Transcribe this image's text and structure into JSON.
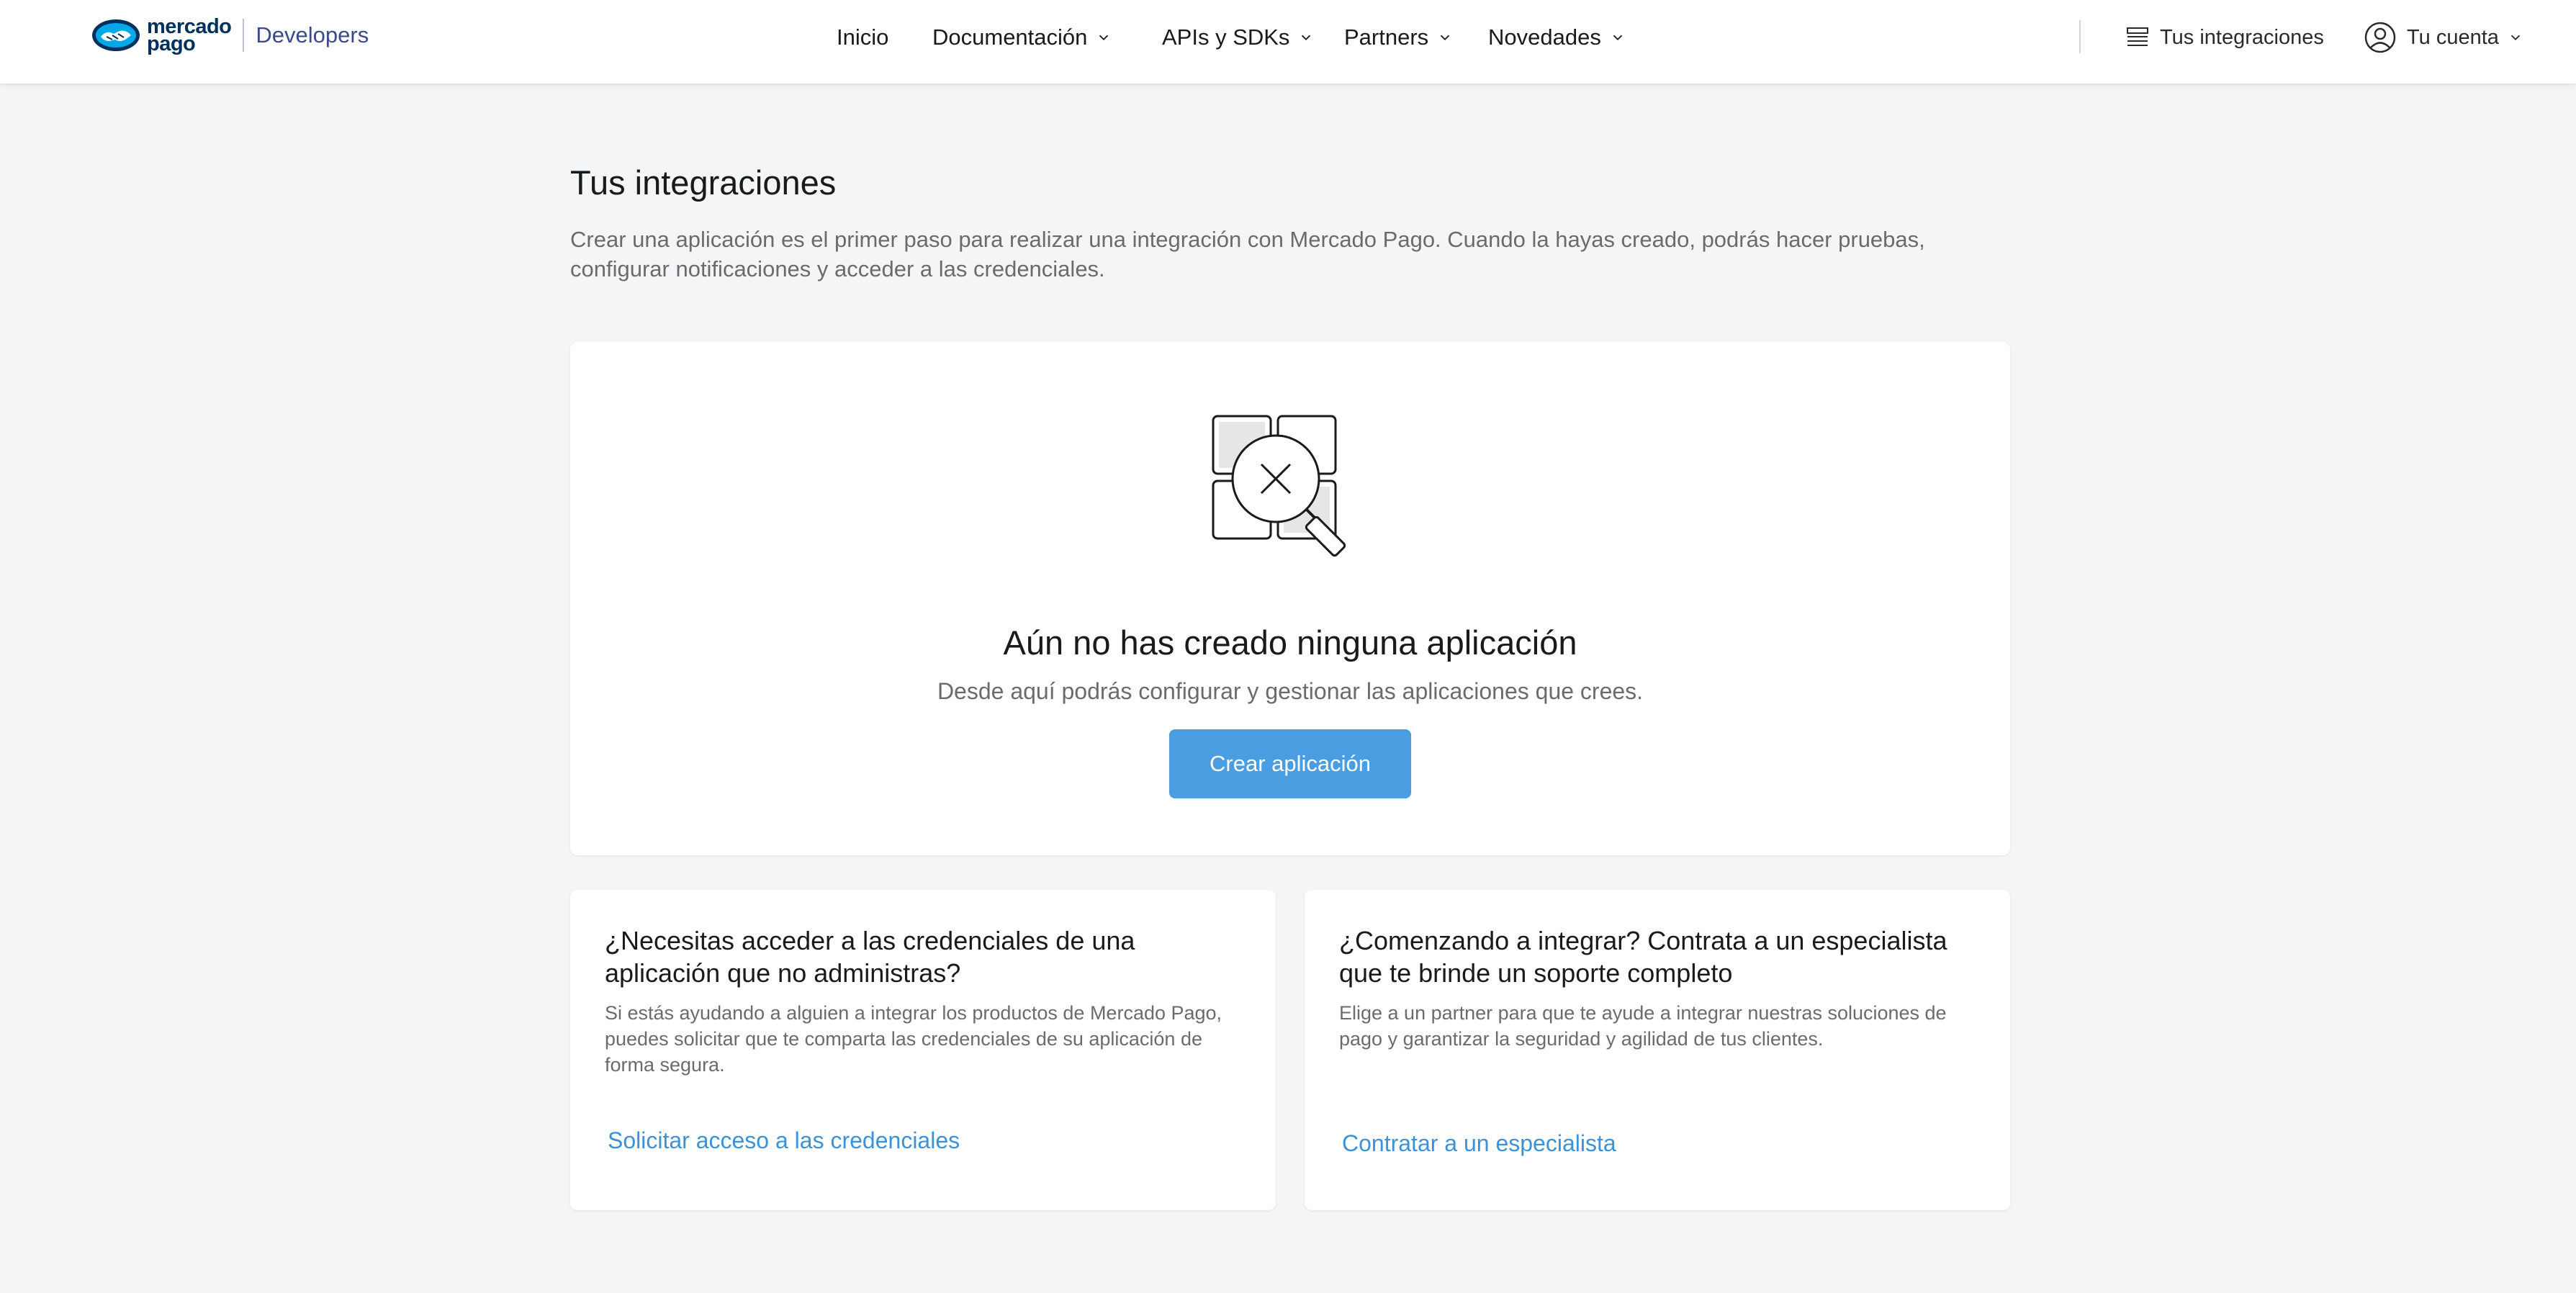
{
  "header": {
    "logo_text_line1": "mercado",
    "logo_text_line2": "pago",
    "developers_label": "Developers",
    "nav": [
      {
        "label": "Inicio"
      },
      {
        "label": "Documentación"
      },
      {
        "label": "APIs y SDKs"
      },
      {
        "label": "Partners"
      },
      {
        "label": "Novedades"
      }
    ],
    "integrations_label": "Tus integraciones",
    "account_label": "Tu cuenta"
  },
  "main": {
    "title": "Tus integraciones",
    "intro": "Crear una aplicación es el primer paso para realizar una integración con Mercado Pago. Cuando la hayas creado, podrás hacer pruebas, configurar notificaciones y acceder a las credenciales.",
    "empty_state": {
      "title": "Aún no has creado ninguna aplicación",
      "subtitle": "Desde aquí podrás configurar y gestionar las aplicaciones que crees.",
      "button_label": "Crear aplicación"
    },
    "cards": [
      {
        "title": "¿Necesitas acceder a las credenciales de una aplicación que no administras?",
        "body": "Si estás ayudando a alguien a integrar los productos de Mercado Pago, puedes solicitar que te comparta las credenciales de su aplicación de forma segura.",
        "link": "Solicitar acceso a las credenciales"
      },
      {
        "title": "¿Comenzando a integrar? Contrata a un especialista que te brinde un soporte completo",
        "body": "Elige a un partner para que te ayude a integrar nuestras soluciones de pago y garantizar la seguridad y agilidad de tus clientes.",
        "link": "Contratar a un especialista"
      }
    ]
  },
  "colors": {
    "accent": "#4a9de0",
    "link": "#3b92d8",
    "brand": "#00305c",
    "background": "#f4f5f7"
  },
  "icons": {
    "logo": "mercado-pago-handshake-logo",
    "integrations": "list-icon",
    "account": "user-circle-icon",
    "dropdown": "chevron-down-icon",
    "empty_state": "search-no-results-illustration"
  }
}
